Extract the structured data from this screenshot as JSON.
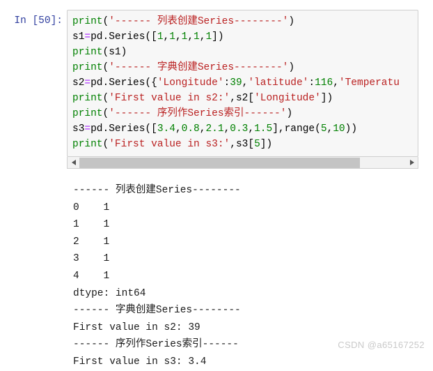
{
  "cell": {
    "prompt": "In [50]:",
    "code_lines": [
      [
        {
          "t": "print",
          "c": "builtin"
        },
        {
          "t": "(",
          "c": "plain"
        },
        {
          "t": "'------ 列表创建Series--------'",
          "c": "str"
        },
        {
          "t": ")",
          "c": "plain"
        }
      ],
      [
        {
          "t": "s1",
          "c": "plain"
        },
        {
          "t": "=",
          "c": "op"
        },
        {
          "t": "pd.Series([",
          "c": "plain"
        },
        {
          "t": "1",
          "c": "num"
        },
        {
          "t": ",",
          "c": "plain"
        },
        {
          "t": "1",
          "c": "num"
        },
        {
          "t": ",",
          "c": "plain"
        },
        {
          "t": "1",
          "c": "num"
        },
        {
          "t": ",",
          "c": "plain"
        },
        {
          "t": "1",
          "c": "num"
        },
        {
          "t": ",",
          "c": "plain"
        },
        {
          "t": "1",
          "c": "num"
        },
        {
          "t": "])",
          "c": "plain"
        }
      ],
      [
        {
          "t": "print",
          "c": "builtin"
        },
        {
          "t": "(s1)",
          "c": "plain"
        }
      ],
      [
        {
          "t": "print",
          "c": "builtin"
        },
        {
          "t": "(",
          "c": "plain"
        },
        {
          "t": "'------ 字典创建Series--------'",
          "c": "str"
        },
        {
          "t": ")",
          "c": "plain"
        }
      ],
      [
        {
          "t": "s2",
          "c": "plain"
        },
        {
          "t": "=",
          "c": "op"
        },
        {
          "t": "pd.Series({",
          "c": "plain"
        },
        {
          "t": "'Longitude'",
          "c": "str"
        },
        {
          "t": ":",
          "c": "plain"
        },
        {
          "t": "39",
          "c": "num"
        },
        {
          "t": ",",
          "c": "plain"
        },
        {
          "t": "'latitude'",
          "c": "str"
        },
        {
          "t": ":",
          "c": "plain"
        },
        {
          "t": "116",
          "c": "num"
        },
        {
          "t": ",",
          "c": "plain"
        },
        {
          "t": "'Temperatu",
          "c": "str"
        }
      ],
      [
        {
          "t": "print",
          "c": "builtin"
        },
        {
          "t": "(",
          "c": "plain"
        },
        {
          "t": "'First value in s2:'",
          "c": "str"
        },
        {
          "t": ",s2[",
          "c": "plain"
        },
        {
          "t": "'Longitude'",
          "c": "str"
        },
        {
          "t": "])",
          "c": "plain"
        }
      ],
      [
        {
          "t": "print",
          "c": "builtin"
        },
        {
          "t": "(",
          "c": "plain"
        },
        {
          "t": "'------ 序列作Series索引------'",
          "c": "str"
        },
        {
          "t": ")",
          "c": "plain"
        }
      ],
      [
        {
          "t": "s3",
          "c": "plain"
        },
        {
          "t": "=",
          "c": "op"
        },
        {
          "t": "pd.Series([",
          "c": "plain"
        },
        {
          "t": "3.4",
          "c": "num"
        },
        {
          "t": ",",
          "c": "plain"
        },
        {
          "t": "0.8",
          "c": "num"
        },
        {
          "t": ",",
          "c": "plain"
        },
        {
          "t": "2.1",
          "c": "num"
        },
        {
          "t": ",",
          "c": "plain"
        },
        {
          "t": "0.3",
          "c": "num"
        },
        {
          "t": ",",
          "c": "plain"
        },
        {
          "t": "1.5",
          "c": "num"
        },
        {
          "t": "],range(",
          "c": "plain"
        },
        {
          "t": "5",
          "c": "num"
        },
        {
          "t": ",",
          "c": "plain"
        },
        {
          "t": "10",
          "c": "num"
        },
        {
          "t": "))",
          "c": "plain"
        }
      ],
      [
        {
          "t": "print",
          "c": "builtin"
        },
        {
          "t": "(",
          "c": "plain"
        },
        {
          "t": "'First value in s3:'",
          "c": "str"
        },
        {
          "t": ",s3[",
          "c": "plain"
        },
        {
          "t": "5",
          "c": "num"
        },
        {
          "t": "])",
          "c": "plain"
        }
      ]
    ],
    "scrollbar": {
      "left_arrow": "◀",
      "right_arrow": "▶",
      "thumb_fraction": 0.86
    }
  },
  "output": {
    "lines": [
      "------ 列表创建Series--------",
      "0    1",
      "1    1",
      "2    1",
      "3    1",
      "4    1",
      "dtype: int64",
      "------ 字典创建Series--------",
      "First value in s2: 39",
      "------ 序列作Series索引------",
      "First value in s3: 3.4"
    ]
  },
  "watermark": {
    "text": "CSDN @a65167252"
  },
  "colors": {
    "prompt": "#303F9F",
    "string": "#BA2121",
    "builtin": "#008000",
    "number": "#008000",
    "operator": "#AA22FF",
    "cell_background": "#f7f7f7",
    "cell_border": "#cfcfcf",
    "scrollbar_thumb": "#c4c4c4",
    "watermark": "#c9c9c9"
  }
}
